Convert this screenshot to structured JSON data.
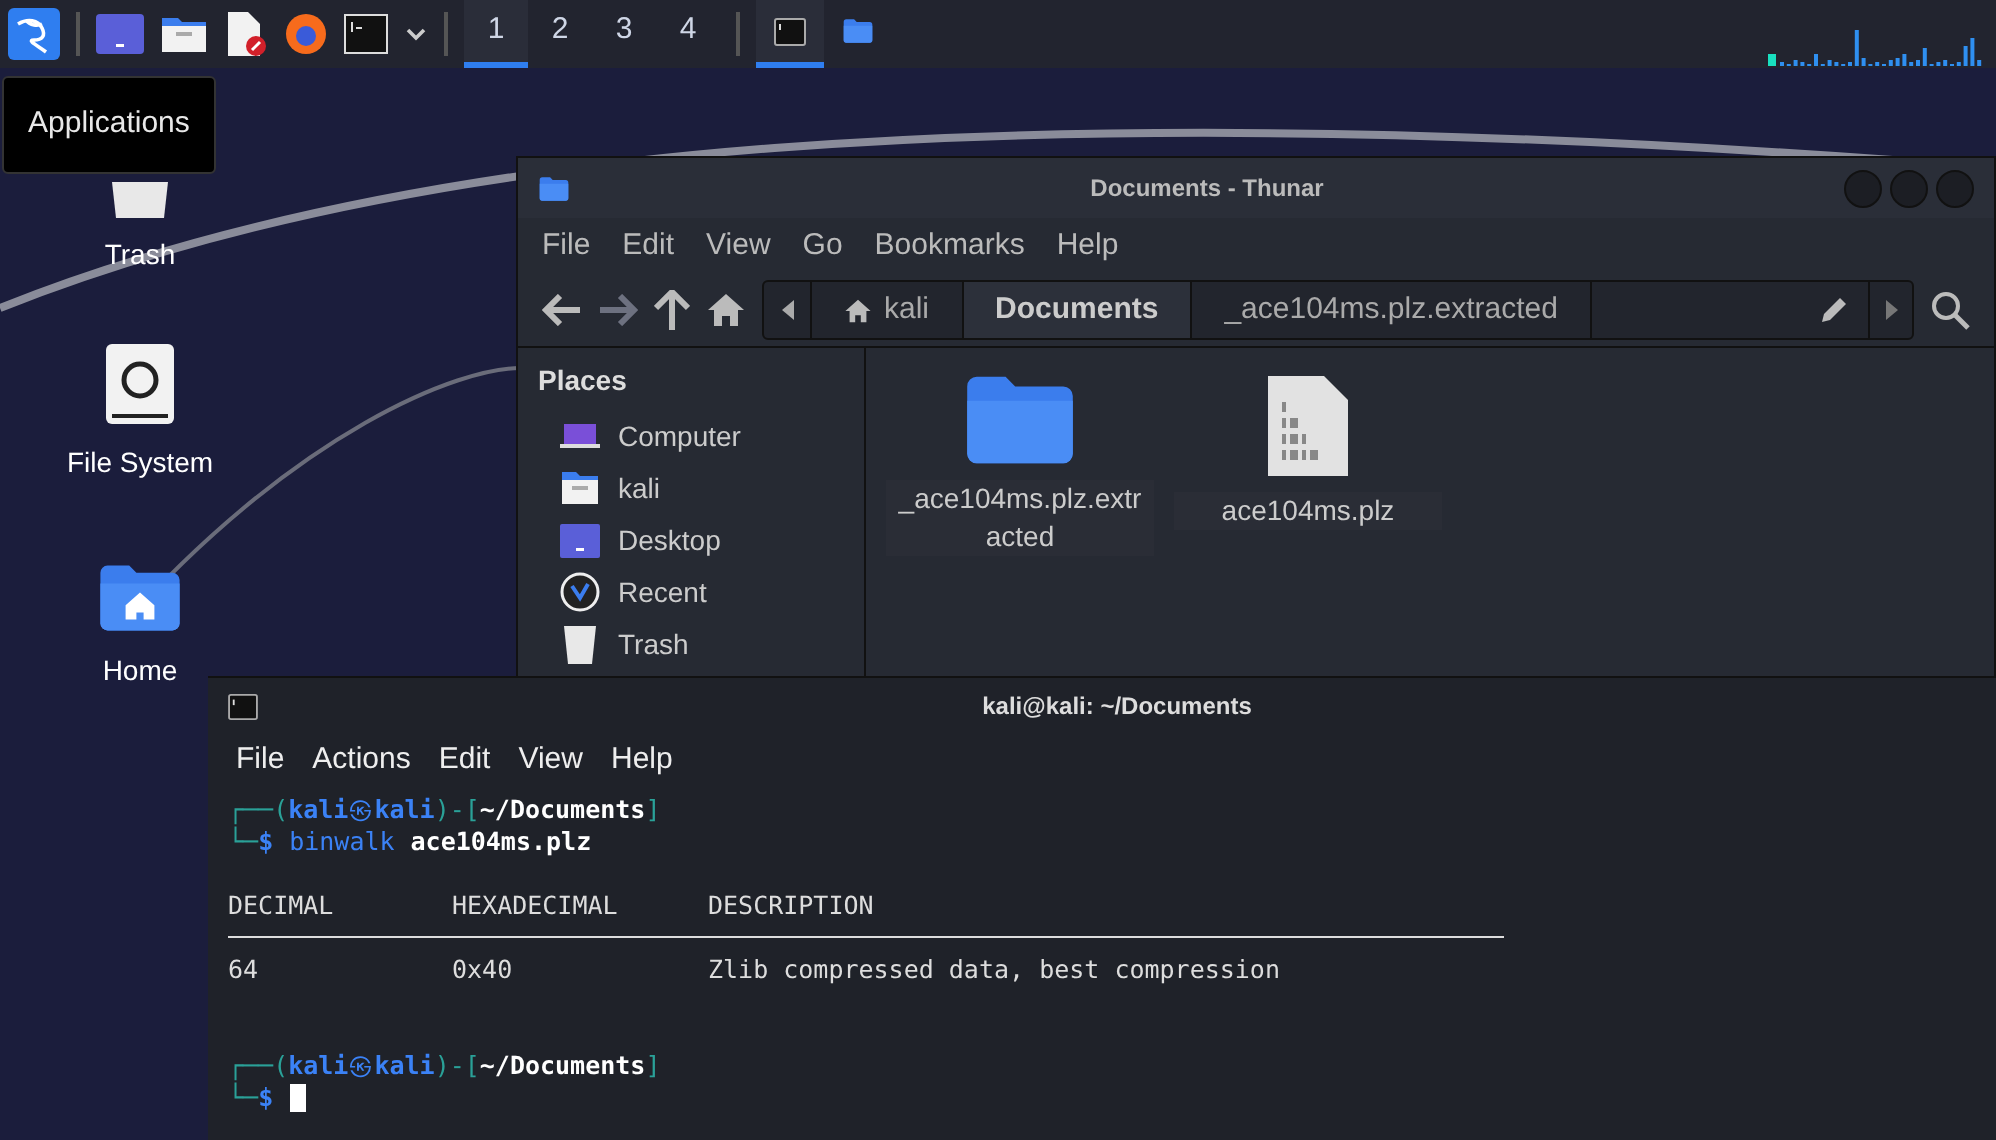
{
  "taskbar": {
    "launchers": [
      {
        "kind": "menu"
      },
      {
        "kind": "desktop"
      },
      {
        "kind": "files"
      },
      {
        "kind": "editor"
      },
      {
        "kind": "browser"
      },
      {
        "kind": "terminal"
      },
      {
        "kind": "dropdown"
      }
    ],
    "workspaces": [
      {
        "label": "1",
        "selected": true
      },
      {
        "label": "2",
        "selected": false
      },
      {
        "label": "3",
        "selected": false
      },
      {
        "label": "4",
        "selected": false
      }
    ],
    "windows": [
      {
        "kind": "terminal",
        "selected": true
      },
      {
        "kind": "folder",
        "selected": false
      }
    ],
    "tooltip": "Applications"
  },
  "desktop_icons": [
    {
      "kind": "trash",
      "label": "Trash"
    },
    {
      "kind": "drive",
      "label": "File System"
    },
    {
      "kind": "home",
      "label": "Home"
    }
  ],
  "thunar": {
    "title": "Documents - Thunar",
    "menu": [
      "File",
      "Edit",
      "View",
      "Go",
      "Bookmarks",
      "Help"
    ],
    "path": [
      {
        "label": "kali",
        "kind": "home",
        "selected": false
      },
      {
        "label": "Documents",
        "kind": "folder",
        "selected": true
      },
      {
        "label": "_ace104ms.plz.extracted",
        "kind": "folder",
        "selected": false
      }
    ],
    "sidebar": {
      "heading": "Places",
      "items": [
        {
          "label": "Computer",
          "kind": "computer"
        },
        {
          "label": "kali",
          "kind": "home"
        },
        {
          "label": "Desktop",
          "kind": "desktop"
        },
        {
          "label": "Recent",
          "kind": "recent"
        },
        {
          "label": "Trash",
          "kind": "trash"
        }
      ]
    },
    "files": [
      {
        "name": "_ace104ms.plz.extracted",
        "kind": "folder"
      },
      {
        "name": "ace104ms.plz",
        "kind": "binary"
      }
    ]
  },
  "terminal": {
    "title": "kali@kali: ~/Documents",
    "menu": [
      "File",
      "Actions",
      "Edit",
      "View",
      "Help"
    ],
    "blocks": [
      {
        "kind": "prompt",
        "open": "┌──(",
        "user": "kali",
        "at": "㉿",
        "host": "kali",
        "mid": ")-[",
        "dir": "~/Documents",
        "close": "]",
        "lead": "└─",
        "dollar": "$",
        "command": "binwalk",
        "arg": "ace104ms.plz"
      },
      {
        "kind": "table",
        "columns": [
          "DECIMAL",
          "HEXADECIMAL",
          "DESCRIPTION"
        ],
        "rows": [
          [
            "64",
            "0x40",
            "Zlib compressed data, best compression"
          ]
        ]
      },
      {
        "kind": "prompt",
        "open": "┌──(",
        "user": "kali",
        "at": "㉿",
        "host": "kali",
        "mid": ")-[",
        "dir": "~/Documents",
        "close": "]",
        "lead": "└─",
        "dollar": "$",
        "cursor": true
      }
    ]
  }
}
